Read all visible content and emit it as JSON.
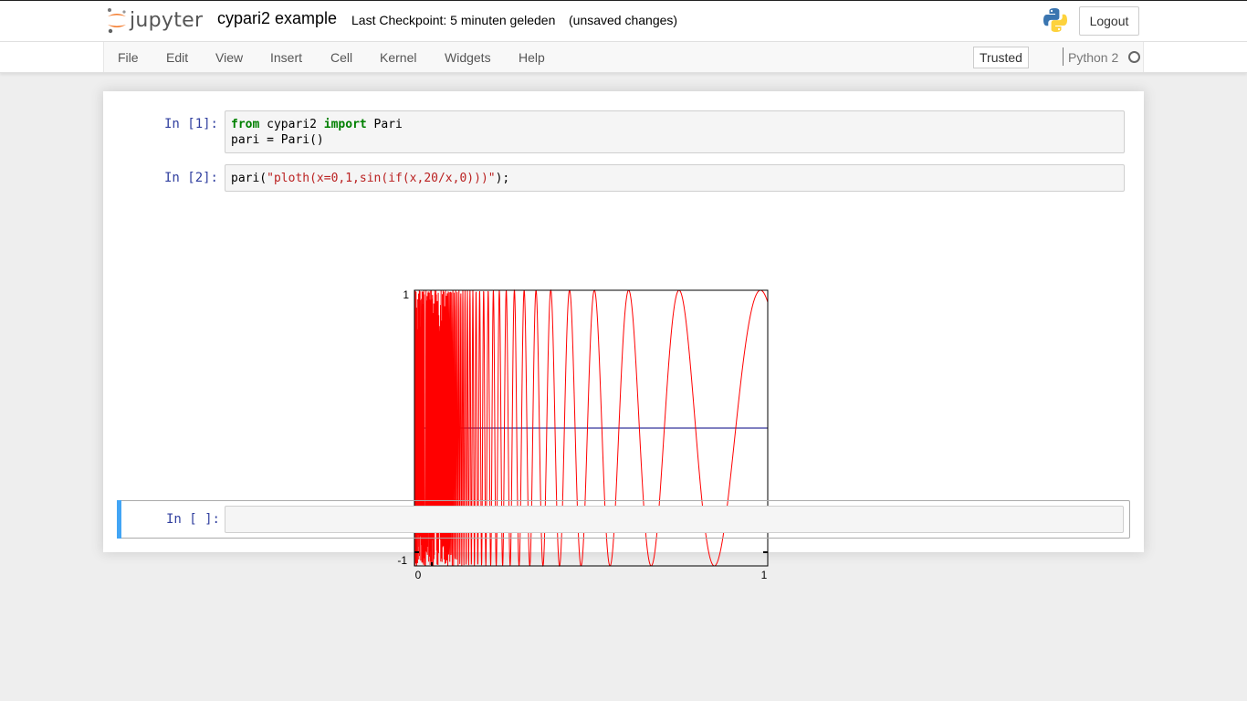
{
  "header": {
    "logo_text": "jupyter",
    "notebook_title": "cypari2 example",
    "checkpoint": "Last Checkpoint: 5 minuten geleden",
    "autosave_status": "(unsaved changes)",
    "logout_label": "Logout"
  },
  "menubar": {
    "items": [
      "File",
      "Edit",
      "View",
      "Insert",
      "Cell",
      "Kernel",
      "Widgets",
      "Help"
    ],
    "trusted_label": "Trusted",
    "kernel_name": "Python 2"
  },
  "cells": [
    {
      "prompt": "In [1]:",
      "code_lines": [
        [
          {
            "t": "from",
            "k": "kw"
          },
          {
            "t": " cypari2 "
          },
          {
            "t": "import",
            "k": "kw"
          },
          {
            "t": " Pari"
          }
        ],
        [
          {
            "t": "pari = Pari()"
          }
        ]
      ]
    },
    {
      "prompt": "In [2]:",
      "code_lines": [
        [
          {
            "t": "pari("
          },
          {
            "t": "\"ploth(x=0,1,sin(if(x,20/x,0)))\"",
            "k": "str"
          },
          {
            "t": ");"
          }
        ]
      ]
    },
    {
      "prompt": "In [ ]:",
      "code_lines": [
        [
          {
            "t": ""
          }
        ]
      ]
    }
  ],
  "chart_data": {
    "type": "line",
    "function": "sin(if(x,20/x,0))",
    "xlim": [
      0,
      1
    ],
    "ylim": [
      -1,
      1
    ],
    "x_ticks": [
      "0",
      "1"
    ],
    "y_ticks": [
      "1",
      "-1"
    ],
    "series": [
      {
        "color": "#ff0000",
        "sample_count": 1500
      }
    ],
    "zero_line_color": "#000080",
    "axes_color": "#000000"
  },
  "icons": {
    "logo": "jupyter-logo-icon",
    "kernel_logo": "python-logo-icon",
    "kernel_status": "kernel-idle-indicator-icon"
  },
  "colors": {
    "prompt": "#303f9f",
    "keyword": "#008000",
    "string": "#ba2121",
    "selected_cell_bar": "#42a5f5",
    "logo_orange": "#f37726"
  }
}
